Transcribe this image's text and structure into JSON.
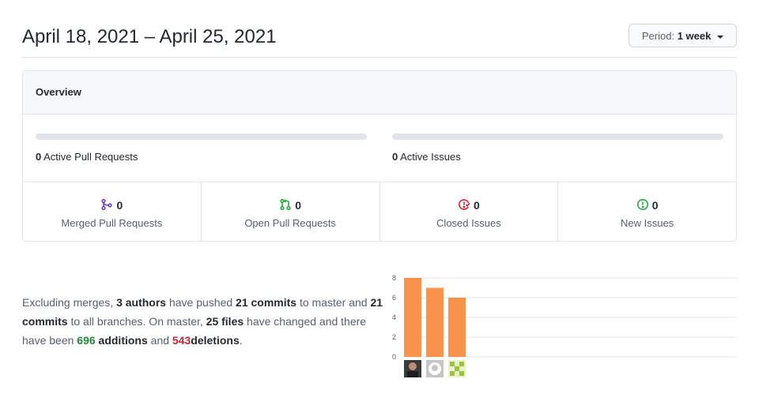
{
  "header": {
    "date_range": "April 18, 2021 – April 25, 2021",
    "period_label": "Period:",
    "period_value": "1 week"
  },
  "overview": {
    "title": "Overview",
    "active_prs": {
      "count": "0",
      "label": "Active Pull Requests",
      "progress": 0
    },
    "active_issues": {
      "count": "0",
      "label": "Active Issues",
      "progress": 0
    },
    "stats": [
      {
        "count": "0",
        "label": "Merged Pull Requests",
        "icon": "git-merge-icon",
        "color": "#6f42c1"
      },
      {
        "count": "0",
        "label": "Open Pull Requests",
        "icon": "git-pull-request-icon",
        "color": "#28a745"
      },
      {
        "count": "0",
        "label": "Closed Issues",
        "icon": "issue-closed-icon",
        "color": "#cb2431"
      },
      {
        "count": "0",
        "label": "New Issues",
        "icon": "issue-opened-icon",
        "color": "#28a745"
      }
    ]
  },
  "summary": {
    "p1": "Excluding merges,",
    "authors": "3 authors",
    "p2": "have pushed",
    "commits_master": "21 commits",
    "p3": "to master and",
    "commits_all": "21 commits",
    "p4": "to all branches. On master,",
    "files": "25 files",
    "p5": "have changed and there have been",
    "additions_num": "696",
    "additions_word": "additions",
    "p6": "and",
    "deletions_num": "543",
    "deletions_word": "deletions",
    "p7": "."
  },
  "chart_data": {
    "type": "bar",
    "categories": [
      "author-1",
      "author-2",
      "author-3"
    ],
    "values": [
      8,
      7,
      6
    ],
    "ylim": [
      0,
      8
    ],
    "yticks": [
      "0",
      "2",
      "4",
      "6",
      "8"
    ],
    "grid": true,
    "bar_color": "#f9924a"
  }
}
